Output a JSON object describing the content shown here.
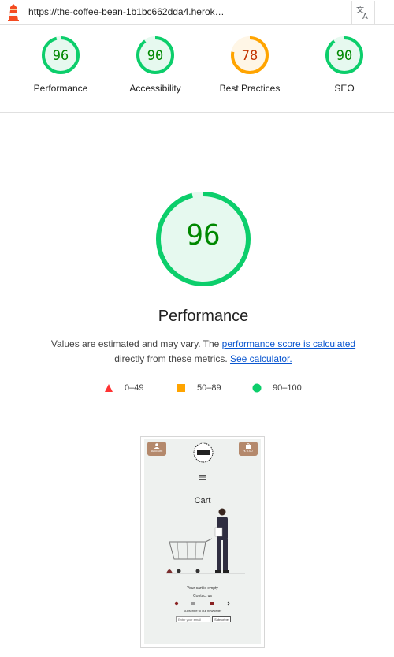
{
  "topbar": {
    "url": "https://the-coffee-bean-1b1bc662dda4.herok…",
    "translate_icon": "translate-icon"
  },
  "categories": [
    {
      "score": "96",
      "label": "Performance",
      "color": "#0cce6b",
      "fill": "#e6f9ef",
      "fraction": 0.96
    },
    {
      "score": "90",
      "label": "Accessibility",
      "color": "#0cce6b",
      "fill": "#e6f9ef",
      "fraction": 0.9
    },
    {
      "score": "78",
      "label": "Best Practices",
      "color": "#ffa400",
      "fill": "#fff6e6",
      "fraction": 0.78
    },
    {
      "score": "90",
      "label": "SEO",
      "color": "#0cce6b",
      "fill": "#e6f9ef",
      "fraction": 0.9
    }
  ],
  "main": {
    "score": "96",
    "fraction": 0.96,
    "title": "Performance",
    "desc_prefix": "Values are estimated and may vary. The ",
    "desc_link1": "performance score is calculated",
    "desc_middle": "directly from these metrics. ",
    "desc_link2": "See calculator."
  },
  "legend": [
    {
      "range": "0–49",
      "shape": "triangle",
      "color": "#ff3333"
    },
    {
      "range": "50–89",
      "shape": "square",
      "color": "#ffa400"
    },
    {
      "range": "90–100",
      "shape": "circle",
      "color": "#0cce6b"
    }
  ],
  "screenshot": {
    "account_label": "Account",
    "bag_label": "€ 0.00",
    "heading": "Cart",
    "empty_text": "Your cart is empty",
    "contact_label": "Contact us",
    "newsletter_label": "Subscribe to our newsletter",
    "email_placeholder": "Enter your email",
    "subscribe_label": "Subscribe"
  }
}
